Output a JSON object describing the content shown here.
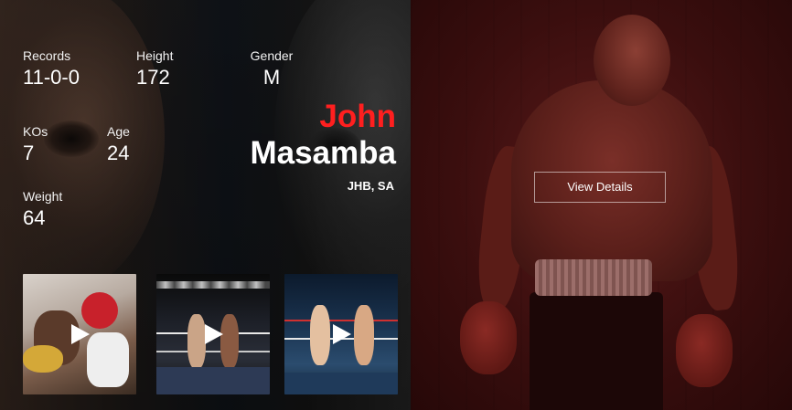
{
  "fighter": {
    "first_name": "John",
    "last_name": "Masamba",
    "location": "JHB, SA"
  },
  "stats": {
    "records": {
      "label": "Records",
      "value": "11-0-0"
    },
    "height": {
      "label": "Height",
      "value": "172"
    },
    "gender": {
      "label": "Gender",
      "value": "M"
    },
    "kos": {
      "label": "KOs",
      "value": "7"
    },
    "age": {
      "label": "Age",
      "value": "24"
    },
    "weight": {
      "label": "Weight",
      "value": "64"
    }
  },
  "videos": [
    {
      "icon": "play-icon"
    },
    {
      "icon": "play-icon"
    },
    {
      "icon": "play-icon"
    }
  ],
  "actions": {
    "view_details_label": "View Details"
  },
  "colors": {
    "accent": "#ff1f1f",
    "text": "#ffffff",
    "right_panel": "#3a0e0e"
  }
}
